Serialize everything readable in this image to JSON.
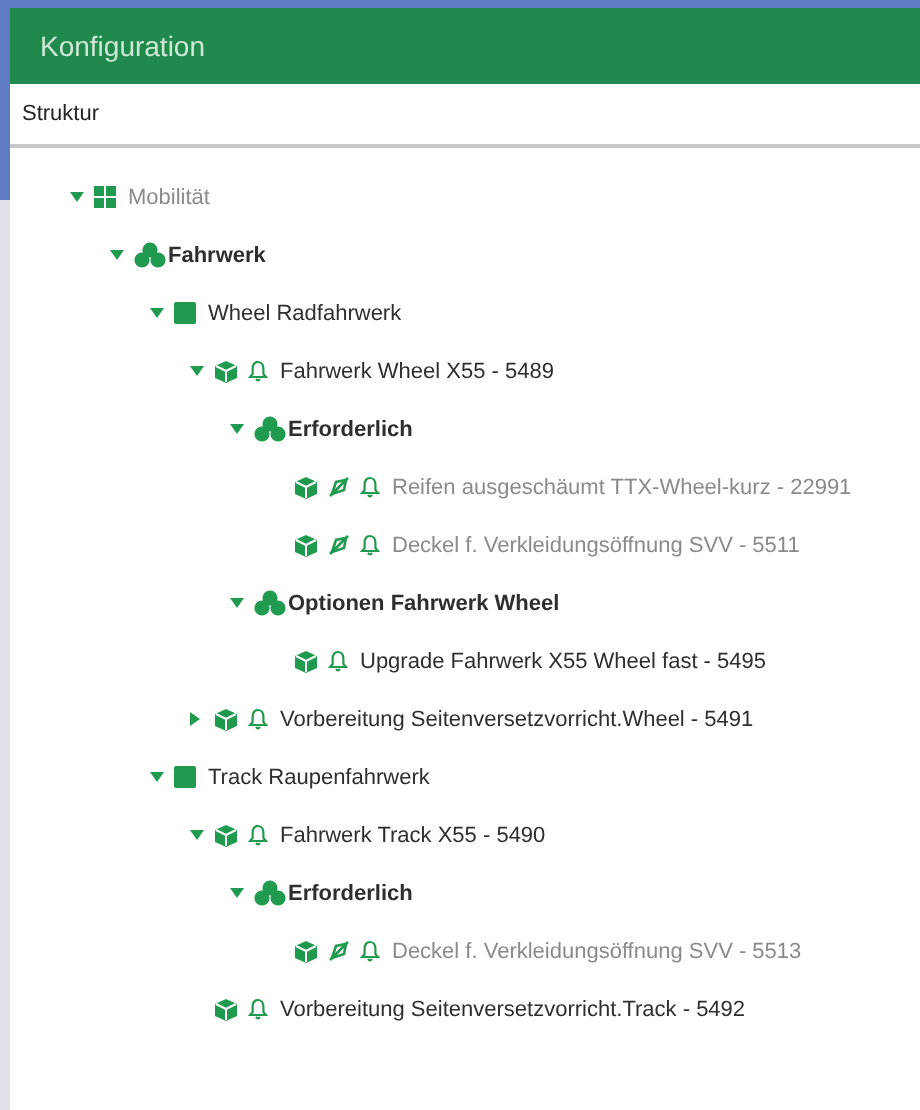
{
  "header": {
    "title": "Konfiguration"
  },
  "panel": {
    "title": "Struktur"
  },
  "tree": [
    {
      "label": "Mobilität",
      "kind": "category",
      "muted": true,
      "expanded": true,
      "children": [
        {
          "label": "Fahrwerk",
          "kind": "group",
          "muted": false,
          "expanded": true,
          "children": [
            {
              "label": "Wheel Radfahrwerk",
              "kind": "folder",
              "muted": false,
              "expanded": true,
              "children": [
                {
                  "label": "Fahrwerk Wheel X55 - 5489",
                  "kind": "article",
                  "muted": false,
                  "excluded": false,
                  "expanded": true,
                  "children": [
                    {
                      "label": "Erforderlich",
                      "kind": "group",
                      "muted": false,
                      "expanded": true,
                      "children": [
                        {
                          "label": "Reifen ausgeschäumt TTX-Wheel-kurz - 22991",
                          "kind": "article",
                          "muted": true,
                          "excluded": true
                        },
                        {
                          "label": "Deckel f. Verkleidungsöffnung SVV - 5511",
                          "kind": "article",
                          "muted": true,
                          "excluded": true
                        }
                      ]
                    },
                    {
                      "label": "Optionen Fahrwerk Wheel",
                      "kind": "group",
                      "muted": false,
                      "expanded": true,
                      "children": [
                        {
                          "label": "Upgrade Fahrwerk X55 Wheel fast - 5495",
                          "kind": "article",
                          "muted": false,
                          "excluded": false
                        }
                      ]
                    }
                  ]
                },
                {
                  "label": "Vorbereitung Seitenversetzvorricht.Wheel - 5491",
                  "kind": "article",
                  "muted": false,
                  "excluded": false,
                  "expanded": false
                }
              ]
            },
            {
              "label": "Track Raupenfahrwerk",
              "kind": "folder",
              "muted": false,
              "expanded": true,
              "children": [
                {
                  "label": "Fahrwerk Track X55 - 5490",
                  "kind": "article",
                  "muted": false,
                  "excluded": false,
                  "expanded": true,
                  "children": [
                    {
                      "label": "Erforderlich",
                      "kind": "group",
                      "muted": false,
                      "expanded": true,
                      "children": [
                        {
                          "label": "Deckel f. Verkleidungsöffnung SVV - 5513",
                          "kind": "article",
                          "muted": true,
                          "excluded": true
                        }
                      ]
                    }
                  ]
                },
                {
                  "label": "Vorbereitung Seitenversetzvorricht.Track - 5492",
                  "kind": "article",
                  "muted": false,
                  "excluded": false
                }
              ]
            }
          ]
        }
      ]
    }
  ]
}
